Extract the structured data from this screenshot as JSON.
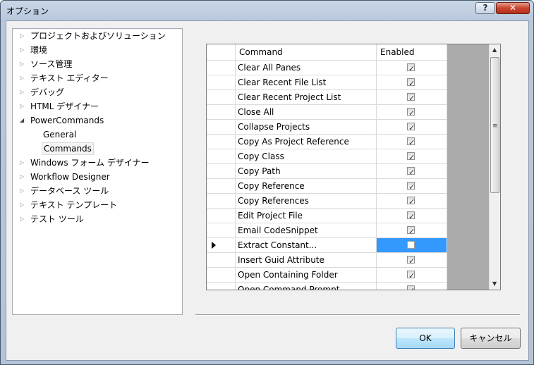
{
  "window": {
    "title": "オプション",
    "help_label": "?",
    "close_label": "✕"
  },
  "tree": {
    "items": [
      {
        "label": "プロジェクトおよびソリューション",
        "expander": "collapsed"
      },
      {
        "label": "環境",
        "expander": "collapsed"
      },
      {
        "label": "ソース管理",
        "expander": "collapsed"
      },
      {
        "label": "テキスト エディター",
        "expander": "collapsed"
      },
      {
        "label": "デバッグ",
        "expander": "collapsed"
      },
      {
        "label": "HTML デザイナー",
        "expander": "collapsed"
      },
      {
        "label": "PowerCommands",
        "expander": "expanded"
      },
      {
        "label": "General",
        "expander": "none"
      },
      {
        "label": "Commands",
        "expander": "none",
        "selected": true
      },
      {
        "label": "Windows フォーム デザイナー",
        "expander": "collapsed"
      },
      {
        "label": "Workflow Designer",
        "expander": "collapsed"
      },
      {
        "label": "データベース ツール",
        "expander": "collapsed"
      },
      {
        "label": "テキスト テンプレート",
        "expander": "collapsed"
      },
      {
        "label": "テスト ツール",
        "expander": "collapsed"
      }
    ]
  },
  "grid": {
    "columns": [
      "Command",
      "Enabled"
    ],
    "rows": [
      {
        "command": "Clear All Panes",
        "enabled": true
      },
      {
        "command": "Clear Recent File List",
        "enabled": true
      },
      {
        "command": "Clear Recent Project List",
        "enabled": true
      },
      {
        "command": "Close All",
        "enabled": true
      },
      {
        "command": "Collapse Projects",
        "enabled": true
      },
      {
        "command": "Copy As Project Reference",
        "enabled": true
      },
      {
        "command": "Copy Class",
        "enabled": true
      },
      {
        "command": "Copy Path",
        "enabled": true
      },
      {
        "command": "Copy Reference",
        "enabled": true
      },
      {
        "command": "Copy References",
        "enabled": true
      },
      {
        "command": "Edit Project File",
        "enabled": true
      },
      {
        "command": "Email CodeSnippet",
        "enabled": true
      },
      {
        "command": "Extract Constant...",
        "enabled": false,
        "current": true
      },
      {
        "command": "Insert Guid Attribute",
        "enabled": true
      },
      {
        "command": "Open Containing Folder",
        "enabled": true
      },
      {
        "command": "Open Command Prompt",
        "enabled": true
      }
    ]
  },
  "buttons": {
    "ok": "OK",
    "cancel": "キャンセル"
  },
  "colors": {
    "selection": "#3399ff",
    "grid_background": "#ababab"
  }
}
